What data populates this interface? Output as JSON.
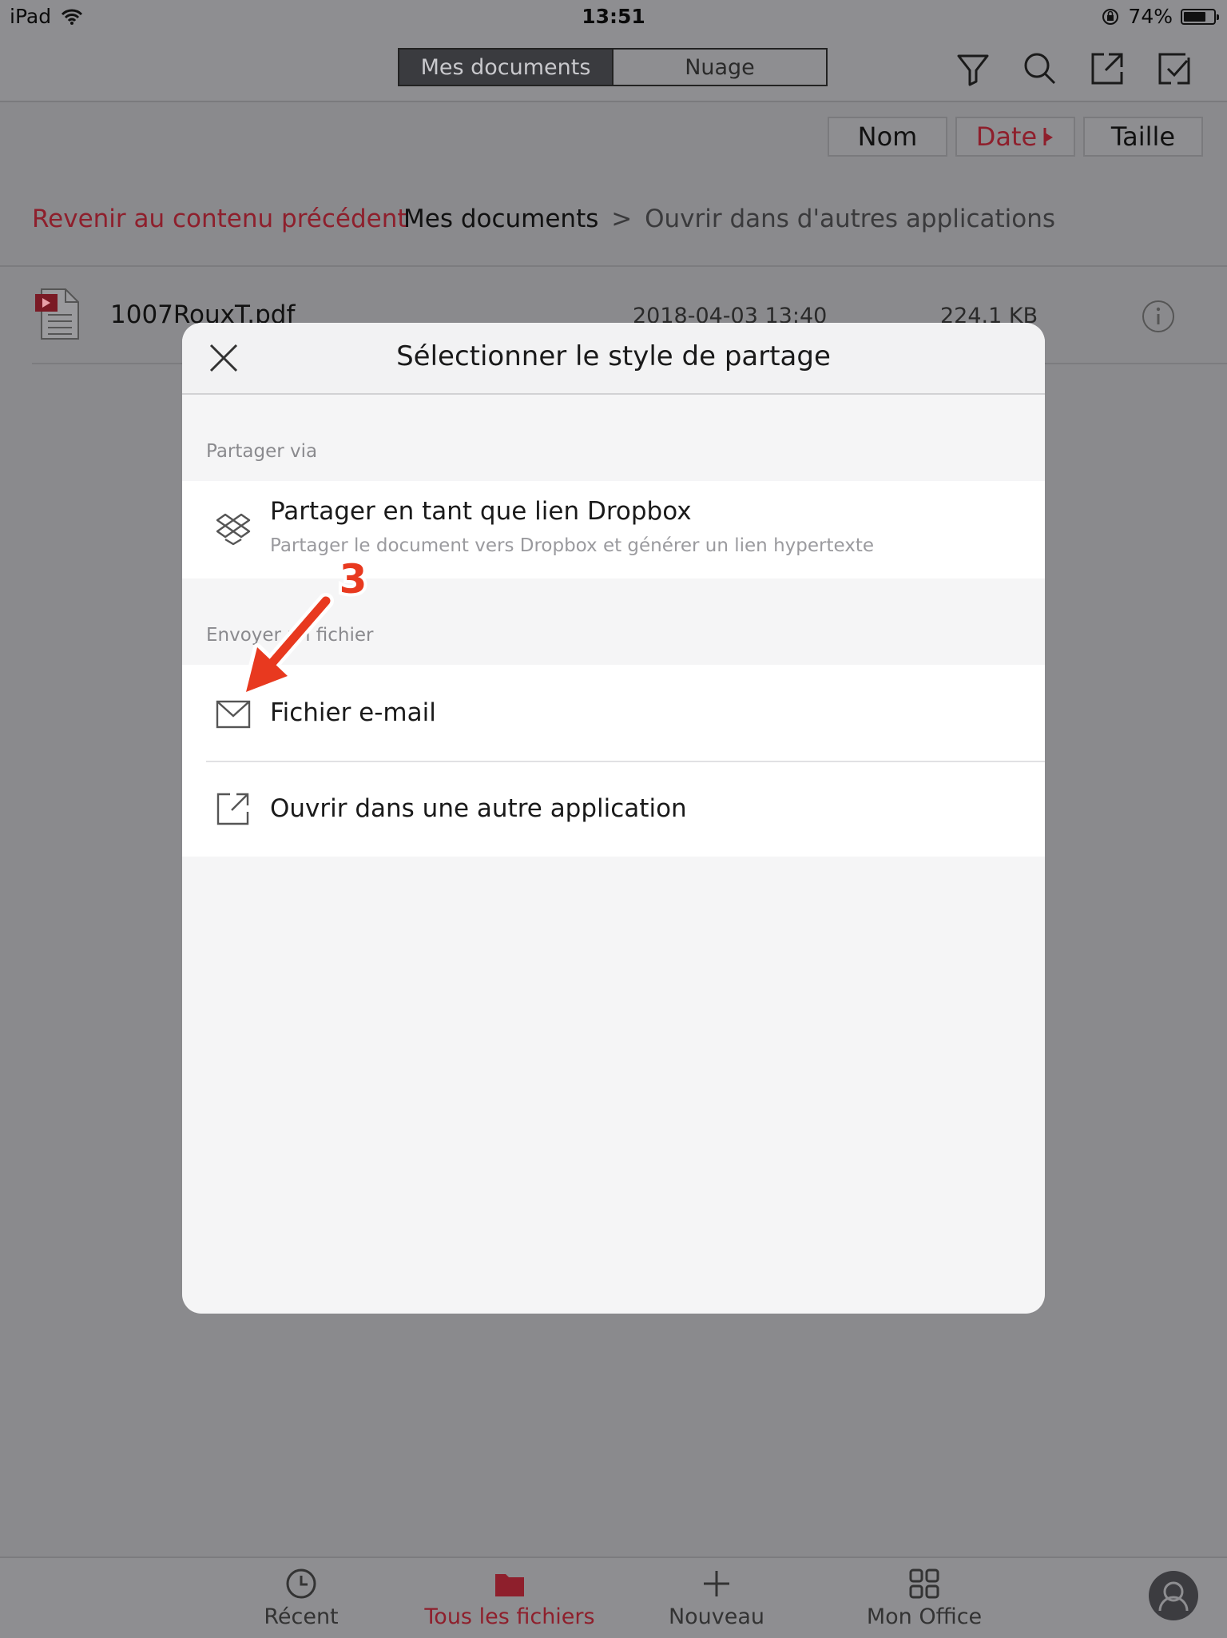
{
  "status_bar": {
    "device": "iPad",
    "time": "13:51",
    "battery": "74%",
    "battery_level": 0.74
  },
  "nav": {
    "segments": [
      "Mes documents",
      "Nuage"
    ],
    "active_segment": 0,
    "icons": [
      "filter-icon",
      "search-icon",
      "share-icon",
      "select-icon"
    ]
  },
  "sort": {
    "name": "Nom",
    "date": "Date",
    "size": "Taille",
    "active": "date"
  },
  "breadcrumb": {
    "back": "Revenir au contenu précédent",
    "root": "Mes documents",
    "separator": ">",
    "current": "Ouvrir dans d'autres applications"
  },
  "file": {
    "name": "1007RouxT.pdf",
    "date": "2018-04-03 13:40",
    "size": "224.1 KB"
  },
  "modal": {
    "title": "Sélectionner le style de partage",
    "section1": "Partager via",
    "dropbox_title": "Partager en tant que lien Dropbox",
    "dropbox_sub": "Partager le document vers Dropbox et générer un lien hypertexte",
    "section2": "Envoyer un fichier",
    "email": "Fichier e-mail",
    "open_other": "Ouvrir dans une autre application"
  },
  "annotation": {
    "number": "3",
    "color": "#e8391f"
  },
  "tabs": [
    {
      "label": "Récent",
      "icon": "clock-icon"
    },
    {
      "label": "Tous les fichiers",
      "icon": "folder-icon"
    },
    {
      "label": "Nouveau",
      "icon": "plus-icon"
    },
    {
      "label": "Mon Office",
      "icon": "grid-icon"
    }
  ],
  "colors": {
    "accent": "#c8283c",
    "overlay": "#8a8a8d"
  }
}
